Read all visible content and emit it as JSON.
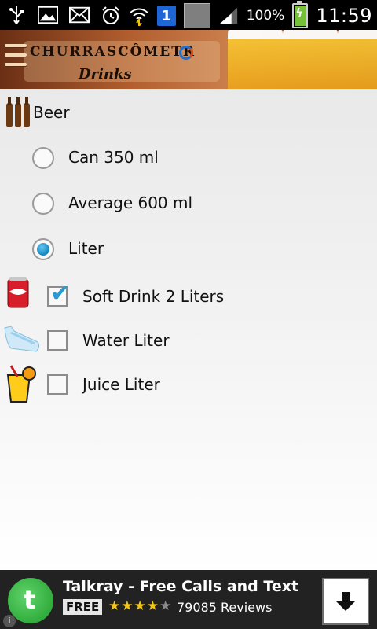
{
  "status_bar": {
    "left_icons": [
      "usb-icon",
      "picture-icon",
      "mail-icon"
    ],
    "right_icons": [
      "alarm-icon",
      "wifi-icon",
      "notification-count-icon",
      "grey-square-icon",
      "signal-icon",
      "battery-icon"
    ],
    "notification_count": "1",
    "battery_percent": "100%",
    "time": "11:59"
  },
  "header": {
    "app_name": "CHURRASCÔMETR",
    "subtitle": "Drinks"
  },
  "beer": {
    "label": "Beer",
    "options": [
      {
        "label": "Can 350 ml",
        "selected": false
      },
      {
        "label": "Average 600 ml",
        "selected": false
      },
      {
        "label": "Liter",
        "selected": true
      }
    ]
  },
  "drinks": [
    {
      "label": "Soft Drink 2 Liters",
      "checked": true,
      "icon": "soda-can-icon"
    },
    {
      "label": "Water Liter",
      "checked": false,
      "icon": "water-bottle-icon"
    },
    {
      "label": "Juice Liter",
      "checked": false,
      "icon": "juice-glass-icon"
    }
  ],
  "ad": {
    "title": "Talkray - Free Calls and Text",
    "price_badge": "FREE",
    "rating_stars": 4,
    "reviews": "79085 Reviews",
    "colors": {
      "logo": "#2aa836"
    }
  }
}
